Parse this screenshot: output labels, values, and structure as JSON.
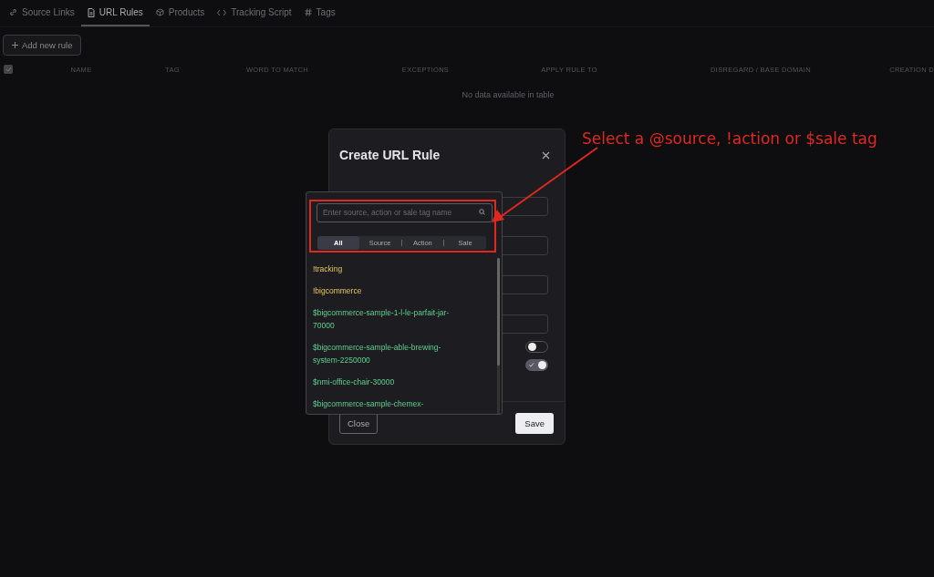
{
  "tabs": [
    {
      "label": "Source Links",
      "selected": false
    },
    {
      "label": "URL Rules",
      "selected": true
    },
    {
      "label": "Products",
      "selected": false
    },
    {
      "label": "Tracking Script",
      "selected": false
    },
    {
      "label": "Tags",
      "selected": false
    }
  ],
  "add_button": "Add new rule",
  "table": {
    "select_all_checked": true,
    "columns": [
      "NAME",
      "TAG",
      "WORD TO MATCH",
      "EXCEPTIONS",
      "APPLY RULE TO",
      "DISREGARD / BASE DOMAIN",
      "CREATION D"
    ],
    "empty_message": "No data available in table"
  },
  "modal": {
    "title": "Create URL Rule",
    "toggles": [
      {
        "on": false
      },
      {
        "on": true
      }
    ],
    "buttons": [
      "Close",
      "Save"
    ]
  },
  "tag_picker": {
    "search": {
      "placeholder": "Enter source, action or sale tag name"
    },
    "filters": [
      {
        "label": "All",
        "selected": true
      },
      {
        "label": "Source",
        "selected": false
      },
      {
        "label": "Action",
        "selected": false
      },
      {
        "label": "Sale",
        "selected": false
      }
    ],
    "items": [
      {
        "label": "!tracking",
        "kind": "action"
      },
      {
        "label": "!bigcommerce",
        "kind": "action"
      },
      {
        "label": "$bigcommerce-sample-1-l-le-parfait-jar-70000",
        "kind": "sale"
      },
      {
        "label": "$bigcommerce-sample-able-brewing-system-2250000",
        "kind": "sale"
      },
      {
        "label": "$nmi-office-chair-30000",
        "kind": "sale"
      },
      {
        "label": "$bigcommerce-sample-chemex-",
        "kind": "sale"
      }
    ]
  },
  "annotation": "Select a @source, !action or $sale tag"
}
